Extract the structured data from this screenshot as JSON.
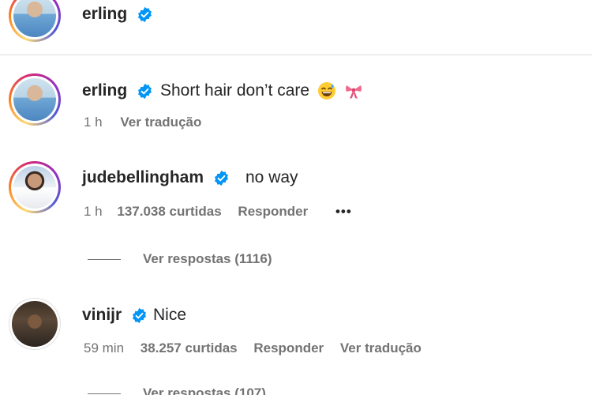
{
  "header": {
    "username": "erling"
  },
  "comments": [
    {
      "username": "erling",
      "text": "Short hair don’t care",
      "emojis": [
        "grinning-sweat-emoji",
        "ribbon-emoji"
      ],
      "time": "1 h",
      "translate": "Ver tradução"
    },
    {
      "username": "judebellingham",
      "text": "no way",
      "time": "1 h",
      "likes": "137.038 curtidas",
      "reply": "Responder",
      "more": "•••",
      "view_replies": "Ver respostas (1116)"
    },
    {
      "username": "vinijr",
      "text": "Nice",
      "time": "59 min",
      "likes": "38.257 curtidas",
      "reply": "Responder",
      "translate": "Ver tradução",
      "view_replies": "Ver respostas (107)"
    }
  ],
  "colors": {
    "verified": "#0095f6",
    "meta": "#737373",
    "text": "#262626"
  }
}
